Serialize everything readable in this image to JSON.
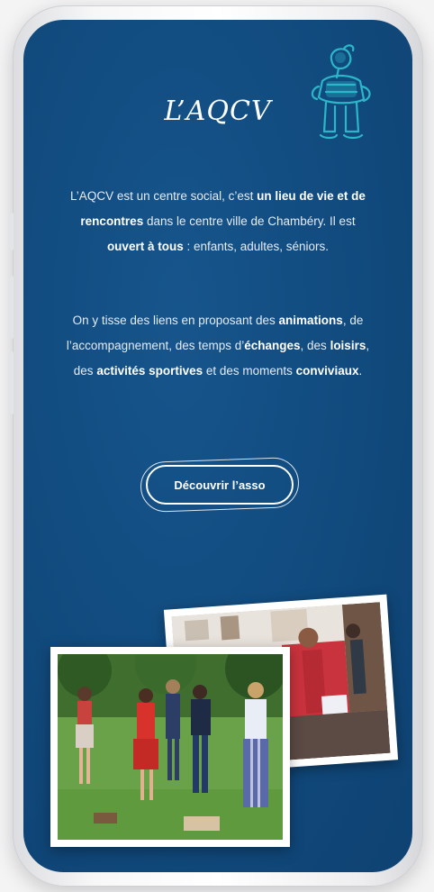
{
  "brand": {
    "logo_text": "L’AQCV"
  },
  "intro": {
    "p1": [
      {
        "t": "L’AQCV est un centre social, c’est ",
        "b": false
      },
      {
        "t": "un lieu de vie et de rencontres",
        "b": true
      },
      {
        "t": " dans le centre ville de Chambéry. Il est ",
        "b": false
      },
      {
        "t": "ouvert à tous",
        "b": true
      },
      {
        "t": " : enfants, adultes, séniors.",
        "b": false
      }
    ],
    "p2": [
      {
        "t": "On y tisse des liens en proposant des ",
        "b": false
      },
      {
        "t": "animations",
        "b": true
      },
      {
        "t": ", de l’accompagnement, des temps d’",
        "b": false
      },
      {
        "t": "échanges",
        "b": true
      },
      {
        "t": ", des ",
        "b": false
      },
      {
        "t": "loisirs",
        "b": true
      },
      {
        "t": ", des ",
        "b": false
      },
      {
        "t": "activités sportives",
        "b": true
      },
      {
        "t": " et des moments ",
        "b": false
      },
      {
        "t": "conviviaux",
        "b": true
      },
      {
        "t": ".",
        "b": false
      }
    ]
  },
  "cta": {
    "label": "Découvrir l’asso"
  },
  "icons": {
    "mascot": "mascot-illustration-icon"
  },
  "colors": {
    "background": "#114a7d",
    "mascot": "#2bb6c9",
    "text": "#ffffff"
  }
}
